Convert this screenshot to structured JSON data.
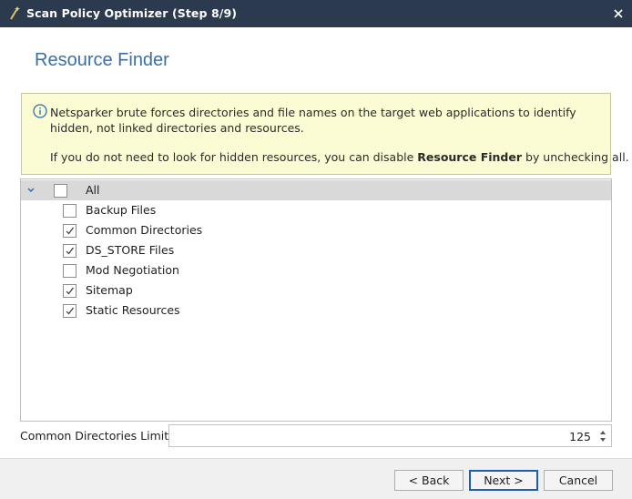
{
  "window": {
    "title": "Scan Policy Optimizer (Step 8/9)",
    "icon": "wand-icon",
    "close_icon": "close-icon"
  },
  "page": {
    "heading": "Resource Finder"
  },
  "info": {
    "icon": "info-icon",
    "line1": "Netsparker brute forces directories and file names on the target web applications to identify hidden, not linked directories and resources.",
    "line2_prefix": "If you do not need to look for hidden resources, you can disable ",
    "line2_bold": "Resource Finder",
    "line2_suffix": " by unchecking all."
  },
  "tree": {
    "root": {
      "label": "All",
      "checked": false,
      "expanded": true
    },
    "items": [
      {
        "label": "Backup Files",
        "checked": false
      },
      {
        "label": "Common Directories",
        "checked": true
      },
      {
        "label": "DS_STORE Files",
        "checked": true
      },
      {
        "label": "Mod Negotiation",
        "checked": false
      },
      {
        "label": "Sitemap",
        "checked": true
      },
      {
        "label": "Static Resources",
        "checked": true
      }
    ]
  },
  "limit": {
    "label": "Common Directories Limit",
    "value": "125"
  },
  "buttons": {
    "back": "< Back",
    "next": "Next >",
    "cancel": "Cancel"
  },
  "colors": {
    "titlebar": "#2b3a4e",
    "heading": "#3a6fa6",
    "info_bg": "#fbfbd4",
    "default_button_border": "#1c5fb0"
  }
}
